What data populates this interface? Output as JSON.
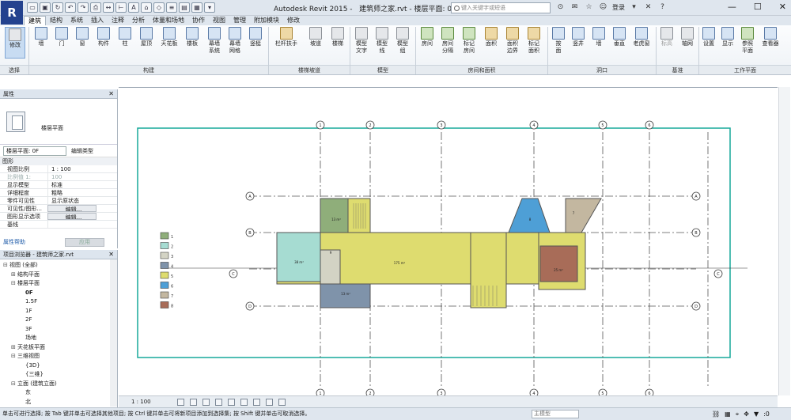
{
  "app": {
    "title": "Autodesk Revit 2015 -",
    "file_view": "建筑师之家.rvt - 楼层平面: 0F",
    "logo": "R"
  },
  "search": {
    "placeholder": "键入关键字或短语"
  },
  "account": {
    "login": "登录"
  },
  "window_controls": {
    "minimize": "—",
    "maximize": "☐",
    "close": "✕"
  },
  "tabs": [
    "建筑",
    "结构",
    "系统",
    "插入",
    "注释",
    "分析",
    "体量和场地",
    "协作",
    "视图",
    "管理",
    "附加模块",
    "修改"
  ],
  "ribbon": {
    "buttons": [
      {
        "label": "修改",
        "icon": "modify-arrow-icon"
      },
      {
        "label": "墙",
        "icon": "wall-icon"
      },
      {
        "label": "门",
        "icon": "door-icon"
      },
      {
        "label": "窗",
        "icon": "window-icon"
      },
      {
        "label": "构件",
        "icon": "component-icon"
      },
      {
        "label": "柱",
        "icon": "column-icon"
      },
      {
        "label": "屋顶",
        "icon": "roof-icon"
      },
      {
        "label": "天花板",
        "icon": "ceiling-icon"
      },
      {
        "label": "楼板",
        "icon": "floor-icon"
      },
      {
        "label": "幕墙\n系统",
        "icon": "curtain-system-icon"
      },
      {
        "label": "幕墙\n网格",
        "icon": "curtain-grid-icon"
      },
      {
        "label": "竖梃",
        "icon": "mullion-icon"
      },
      {
        "label": "栏杆扶手",
        "icon": "railing-icon"
      },
      {
        "label": "坡道",
        "icon": "ramp-icon"
      },
      {
        "label": "楼梯",
        "icon": "stair-icon"
      },
      {
        "label": "模型\n文字",
        "icon": "model-text-icon"
      },
      {
        "label": "模型\n线",
        "icon": "model-line-icon"
      },
      {
        "label": "模型\n组",
        "icon": "model-group-icon"
      },
      {
        "label": "房间",
        "icon": "room-icon"
      },
      {
        "label": "房间\n分隔",
        "icon": "room-separator-icon"
      },
      {
        "label": "标记\n房间",
        "icon": "tag-room-icon"
      },
      {
        "label": "面积",
        "icon": "area-icon"
      },
      {
        "label": "面积\n边界",
        "icon": "area-boundary-icon"
      },
      {
        "label": "标记\n面积",
        "icon": "tag-area-icon"
      },
      {
        "label": "按\n面",
        "icon": "by-face-icon"
      },
      {
        "label": "竖井",
        "icon": "shaft-icon"
      },
      {
        "label": "墙",
        "icon": "wall-opening-icon"
      },
      {
        "label": "垂直",
        "icon": "vertical-opening-icon"
      },
      {
        "label": "老虎窗",
        "icon": "dormer-icon"
      },
      {
        "label": "标高",
        "icon": "level-icon"
      },
      {
        "label": "轴网",
        "icon": "grid-icon"
      },
      {
        "label": "设置",
        "icon": "set-workplane-icon"
      },
      {
        "label": "显示",
        "icon": "show-workplane-icon"
      },
      {
        "label": "参照\n平面",
        "icon": "ref-plane-icon"
      },
      {
        "label": "查看器",
        "icon": "viewer-icon"
      }
    ],
    "panels": [
      "选择",
      "构建",
      "楼梯坡道",
      "模型",
      "房间和面积",
      "洞口",
      "基准",
      "工作平面"
    ]
  },
  "properties": {
    "title": "属性",
    "type_name": "楼层平面",
    "type_selector": "楼层平面: 0F",
    "edit_type": "编辑类型",
    "category": "图形",
    "rows": [
      {
        "k": "视图比例",
        "v": "1 : 100",
        "dim": false
      },
      {
        "k": "比例值 1:",
        "v": "100",
        "dim": true
      },
      {
        "k": "显示模型",
        "v": "标准",
        "dim": false
      },
      {
        "k": "详细程度",
        "v": "粗略",
        "dim": false
      },
      {
        "k": "零件可见性",
        "v": "显示原状态",
        "dim": false
      },
      {
        "k": "可见性/图形...",
        "v": "编辑...",
        "dim": false
      },
      {
        "k": "图形显示选项",
        "v": "编辑...",
        "dim": false
      },
      {
        "k": "基线",
        "v": "",
        "dim": false
      }
    ],
    "help": "属性帮助",
    "apply": "应用"
  },
  "browser": {
    "title": "项目浏览器 - 建筑师之家.rvt",
    "items": [
      {
        "label": "视图 (全部)",
        "level": 0,
        "toggle": "⊟",
        "bold": false
      },
      {
        "label": "结构平面",
        "level": 1,
        "toggle": "⊞",
        "bold": false
      },
      {
        "label": "楼层平面",
        "level": 1,
        "toggle": "⊟",
        "bold": false
      },
      {
        "label": "0F",
        "level": 2,
        "toggle": "",
        "bold": true
      },
      {
        "label": "1.5F",
        "level": 2,
        "toggle": "",
        "bold": false
      },
      {
        "label": "1F",
        "level": 2,
        "toggle": "",
        "bold": false
      },
      {
        "label": "2F",
        "level": 2,
        "toggle": "",
        "bold": false
      },
      {
        "label": "3F",
        "level": 2,
        "toggle": "",
        "bold": false
      },
      {
        "label": "场地",
        "level": 2,
        "toggle": "",
        "bold": false
      },
      {
        "label": "天花板平面",
        "level": 1,
        "toggle": "⊞",
        "bold": false
      },
      {
        "label": "三维视图",
        "level": 1,
        "toggle": "⊟",
        "bold": false
      },
      {
        "label": "{3D}",
        "level": 2,
        "toggle": "",
        "bold": false
      },
      {
        "label": "{三维}",
        "level": 2,
        "toggle": "",
        "bold": false
      },
      {
        "label": "立面 (建筑立面)",
        "level": 1,
        "toggle": "⊟",
        "bold": false
      },
      {
        "label": "东",
        "level": 2,
        "toggle": "",
        "bold": false
      },
      {
        "label": "北",
        "level": 2,
        "toggle": "",
        "bold": false
      }
    ]
  },
  "plan": {
    "legend": [
      {
        "num": "1",
        "color": "#8fae7a"
      },
      {
        "num": "2",
        "color": "#a6dcd2"
      },
      {
        "num": "3",
        "color": "#d3d3c4"
      },
      {
        "num": "4",
        "color": "#7f93aa"
      },
      {
        "num": "5",
        "color": "#dedc6f"
      },
      {
        "num": "6",
        "color": "#4e9fd6"
      },
      {
        "num": "7",
        "color": "#c3b7a0"
      },
      {
        "num": "8",
        "color": "#a86c58"
      }
    ],
    "room_tags": [
      "13 m²",
      "38 m²",
      "9",
      "175 m²",
      "13 m²",
      "8",
      "7",
      "25 m²"
    ],
    "grid_bubbles": [
      "1",
      "2",
      "3",
      "4",
      "5",
      "6",
      "7",
      "8",
      "A",
      "B",
      "C",
      "D",
      "E"
    ]
  },
  "viewbar": {
    "scale": "1 : 100"
  },
  "status": {
    "text": "单击可进行选择; 按 Tab 键并单击可选择其他项目; 按 Ctrl 键并单击可将新项目添加到选择集; 按 Shift 键并单击可取消选择。",
    "model": "主模型",
    "filter_count": ":0"
  },
  "colors": {
    "crop_region": "#17a89a",
    "grid_line": "#555555",
    "accent": "#24428e"
  }
}
